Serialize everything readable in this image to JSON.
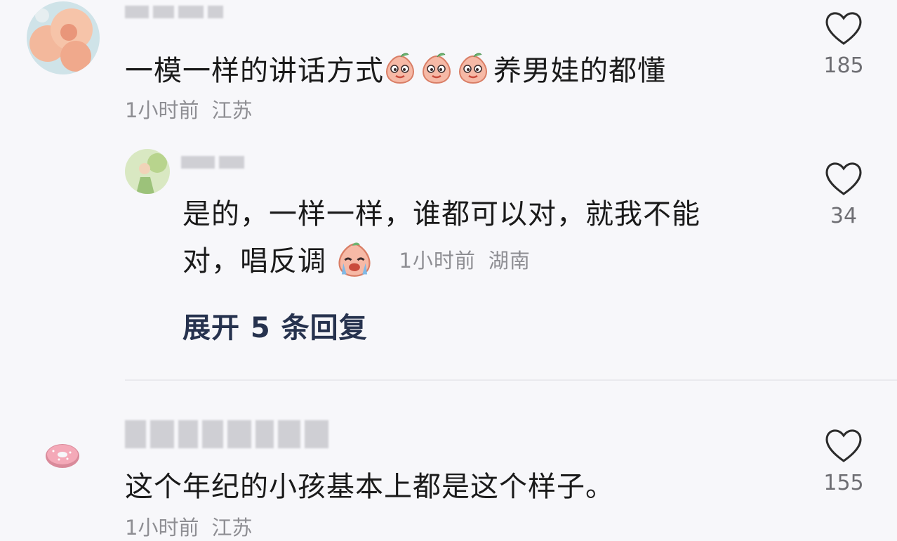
{
  "comments": [
    {
      "text_before": "一模一样的讲话方式",
      "text_after": "养男娃的都懂",
      "emoji_count": 3,
      "time": "1小时前",
      "location": "江苏",
      "likes": "185",
      "replies": [
        {
          "text_line1": "是的，一样一样，谁都可以对，就我不能",
          "text_line2": "对，唱反调",
          "time": "1小时前",
          "location": "湖南",
          "likes": "34"
        }
      ],
      "expand_label": "展开 5 条回复"
    },
    {
      "text": "这个年纪的小孩基本上都是这个样子。",
      "time": "1小时前",
      "location": "江苏",
      "likes": "155"
    }
  ],
  "icons": {
    "like": "heart-outline-icon",
    "emoji": "peach-face-emoji"
  },
  "colors": {
    "text": "#1a1a1a",
    "meta": "#8e8e93",
    "expand": "#26324e",
    "background": "#f7f7fa"
  }
}
